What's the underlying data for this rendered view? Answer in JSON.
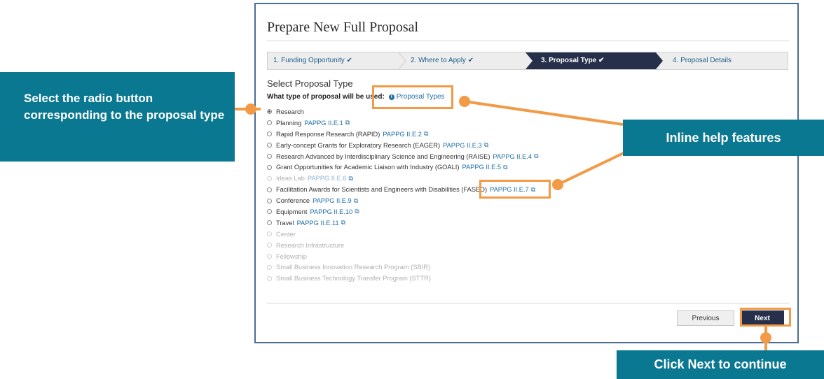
{
  "window": {
    "title": "Prepare New Full Proposal"
  },
  "steps": [
    {
      "label": "1. Funding Opportunity ✔",
      "state": "done"
    },
    {
      "label": "2. Where to Apply ✔",
      "state": "done"
    },
    {
      "label": "3. Proposal Type ✔",
      "state": "active"
    },
    {
      "label": "4. Proposal Details",
      "state": "todo"
    }
  ],
  "form": {
    "section_title": "Select Proposal Type",
    "question": "What type of proposal will be used:",
    "help_link": "Proposal Types",
    "options": [
      {
        "label": "Research",
        "link": "",
        "selected": true,
        "disabled": false
      },
      {
        "label": "Planning",
        "link": "PAPPG II.E.1",
        "selected": false,
        "disabled": false
      },
      {
        "label": "Rapid Response Research (RAPID)",
        "link": "PAPPG II.E.2",
        "selected": false,
        "disabled": false
      },
      {
        "label": "Early-concept Grants for Exploratory Research (EAGER)",
        "link": "PAPPG II.E.3",
        "selected": false,
        "disabled": false
      },
      {
        "label": "Research Advanced by Interdisciplinary Science and Engineering (RAISE)",
        "link": "PAPPG II.E.4",
        "selected": false,
        "disabled": false
      },
      {
        "label": "Grant Opportunities for Academic Liaison with Industry (GOALI)",
        "link": "PAPPG II.E.5",
        "selected": false,
        "disabled": false
      },
      {
        "label": "Ideas Lab",
        "link": "PAPPG II.E.6",
        "selected": false,
        "disabled": true
      },
      {
        "label": "Facilitation Awards for Scientists and Engineers with Disabilities (FASED)",
        "link": "PAPPG II.E.7",
        "selected": false,
        "disabled": false
      },
      {
        "label": "Conference",
        "link": "PAPPG II.E.9",
        "selected": false,
        "disabled": false
      },
      {
        "label": "Equipment",
        "link": "PAPPG II.E.10",
        "selected": false,
        "disabled": false
      },
      {
        "label": "Travel",
        "link": "PAPPG II.E.11",
        "selected": false,
        "disabled": false
      },
      {
        "label": "Center",
        "link": "",
        "selected": false,
        "disabled": true
      },
      {
        "label": "Research Infrastructure",
        "link": "",
        "selected": false,
        "disabled": true
      },
      {
        "label": "Fellowship",
        "link": "",
        "selected": false,
        "disabled": true
      },
      {
        "label": "Small Business Innovation Research Program (SBIR)",
        "link": "",
        "selected": false,
        "disabled": true
      },
      {
        "label": "Small Business Technology Transfer Program (STTR)",
        "link": "",
        "selected": false,
        "disabled": true
      }
    ]
  },
  "buttons": {
    "previous": "Previous",
    "next": "Next"
  },
  "callouts": {
    "radio": "Select the radio button corresponding to the proposal type",
    "help": "Inline help features",
    "next": "Click Next to continue"
  },
  "colors": {
    "callout": "#0b7891",
    "highlight": "#f29a45",
    "active_step": "#26304a",
    "link": "#1f6ea5"
  }
}
